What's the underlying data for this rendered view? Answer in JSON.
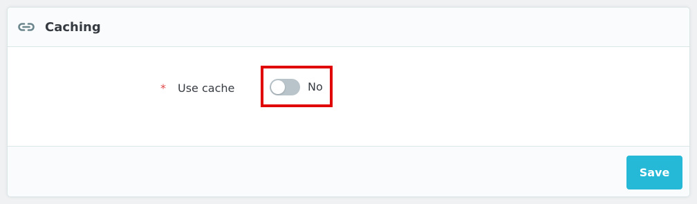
{
  "panel": {
    "title": "Caching",
    "header_icon": "link-icon"
  },
  "form": {
    "required_marker": "*",
    "use_cache_label": "Use cache",
    "use_cache_value": false,
    "use_cache_state_text": "No",
    "highlight_color": "#e10000"
  },
  "footer": {
    "save_label": "Save"
  },
  "colors": {
    "accent": "#25b9d7",
    "required": "#e04a4a",
    "toggle_off": "#b8c4ca"
  }
}
